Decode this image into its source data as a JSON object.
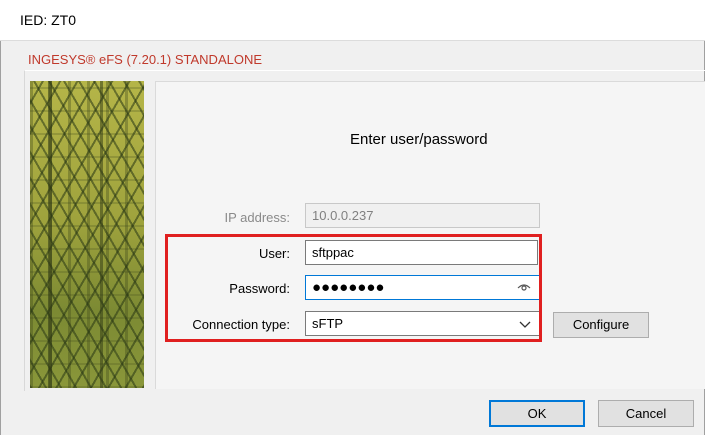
{
  "window": {
    "title": "IED: ZT0"
  },
  "product_label": "INGESYS® eFS (7.20.1) STANDALONE",
  "login": {
    "heading": "Enter user/password",
    "ip_label": "IP address:",
    "ip_value": "10.0.0.237",
    "user_label": "User:",
    "user_value": "sftppac",
    "password_label": "Password:",
    "password_mask": "●●●●●●●●",
    "connection_label": "Connection type:",
    "connection_value": "sFTP",
    "configure_label": "Configure"
  },
  "buttons": {
    "ok": "OK",
    "cancel": "Cancel"
  },
  "icons": {
    "password_toggle": "eye-icon",
    "dropdown": "chevron-down-icon"
  },
  "colors": {
    "highlight": "#e02020",
    "focus": "#0078d7",
    "product": "#c0392b"
  }
}
